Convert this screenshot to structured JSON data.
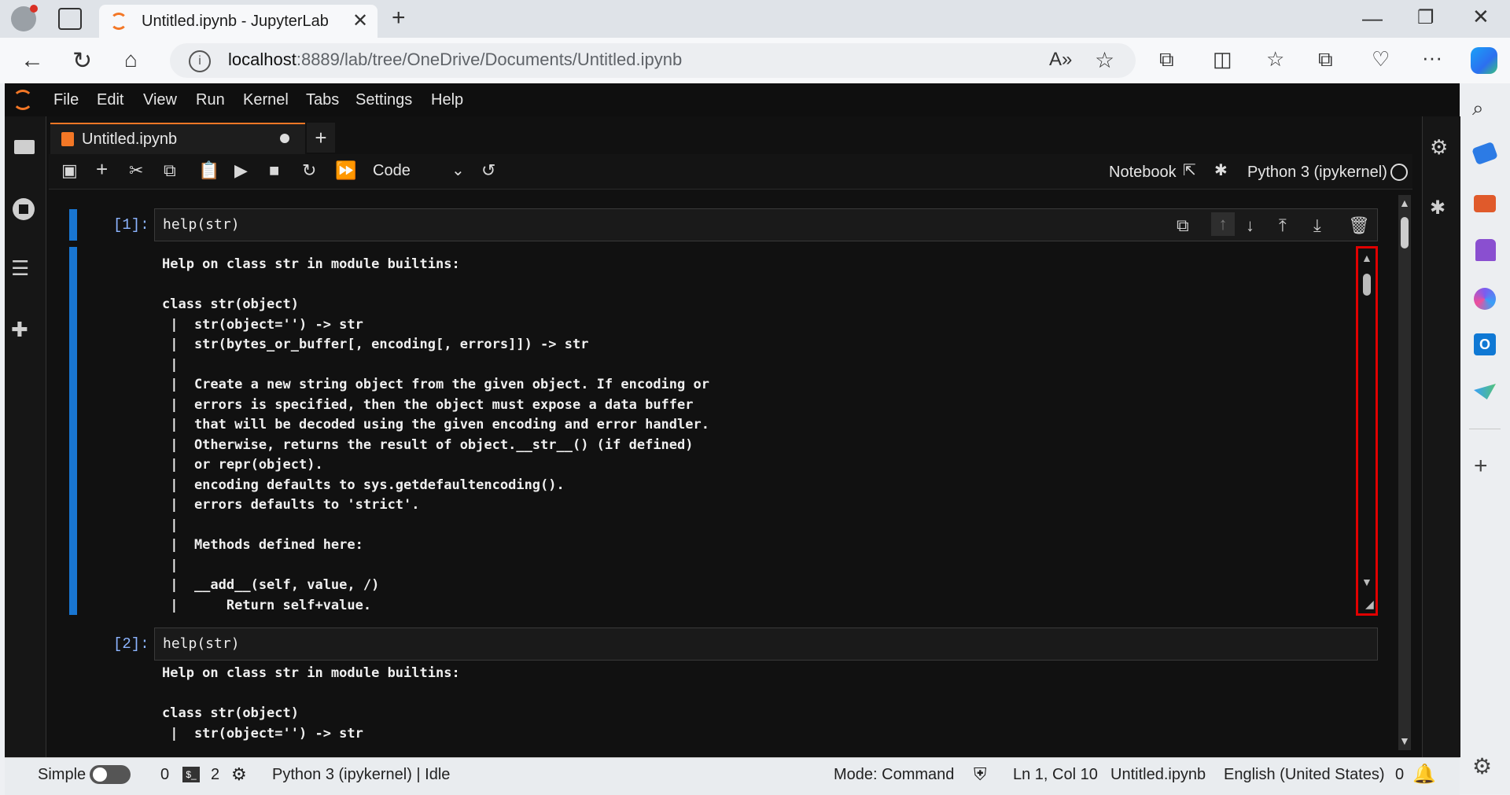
{
  "browser": {
    "tab_title": "Untitled.ipynb - JupyterLab",
    "url_prefix": "localhost",
    "url_rest": ":8889/lab/tree/OneDrive/Documents/Untitled.ipynb"
  },
  "menu": [
    "File",
    "Edit",
    "View",
    "Run",
    "Kernel",
    "Tabs",
    "Settings",
    "Help"
  ],
  "notebook_tab": {
    "label": "Untitled.ipynb"
  },
  "toolbar": {
    "cell_type": "Code",
    "notebook_label": "Notebook",
    "kernel": "Python 3 (ipykernel)"
  },
  "cells": [
    {
      "prompt": "[1]:",
      "code": "help(str)",
      "output": "Help on class str in module builtins:\n\nclass str(object)\n |  str(object='') -> str\n |  str(bytes_or_buffer[, encoding[, errors]]) -> str\n |\n |  Create a new string object from the given object. If encoding or\n |  errors is specified, then the object must expose a data buffer\n |  that will be decoded using the given encoding and error handler.\n |  Otherwise, returns the result of object.__str__() (if defined)\n |  or repr(object).\n |  encoding defaults to sys.getdefaultencoding().\n |  errors defaults to 'strict'.\n |\n |  Methods defined here:\n |\n |  __add__(self, value, /)\n |      Return self+value."
    },
    {
      "prompt": "[2]:",
      "code": "help(str)",
      "output": "Help on class str in module builtins:\n\nclass str(object)\n |  str(object='') -> str"
    }
  ],
  "status": {
    "mode_label": "Simple",
    "terminals": "0",
    "kernels": "2",
    "kernel_status": "Python 3 (ipykernel) | Idle",
    "mode": "Mode: Command",
    "position": "Ln 1, Col 10",
    "file": "Untitled.ipynb",
    "language": "English (United States)",
    "notifications": "0"
  },
  "colors": {
    "accent": "#f37726",
    "cell_active": "#1976d2",
    "highlight": "#e00000"
  }
}
